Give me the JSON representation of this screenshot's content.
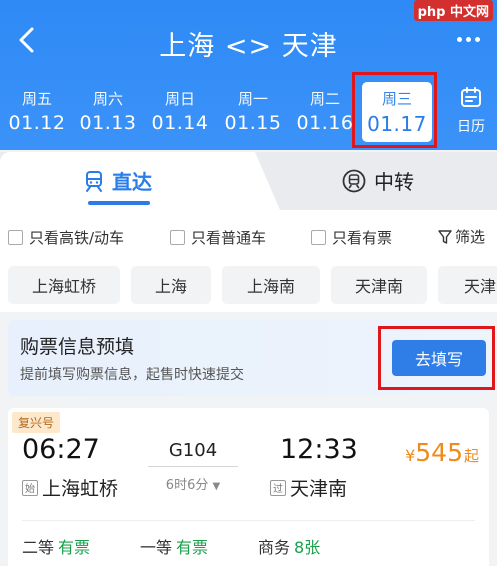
{
  "header": {
    "title": "上海 <> 天津",
    "watermark": "php 中文网"
  },
  "dates": [
    {
      "weekday": "周五",
      "date": "01.12",
      "selected": false
    },
    {
      "weekday": "周六",
      "date": "01.13",
      "selected": false
    },
    {
      "weekday": "周日",
      "date": "01.14",
      "selected": false
    },
    {
      "weekday": "周一",
      "date": "01.15",
      "selected": false
    },
    {
      "weekday": "周二",
      "date": "01.16",
      "selected": false
    },
    {
      "weekday": "周三",
      "date": "01.17",
      "selected": true
    }
  ],
  "calendar_label": "日历",
  "tabs": {
    "direct": "直达",
    "transfer": "中转"
  },
  "filters": {
    "high_speed": "只看高铁/动车",
    "normal": "只看普通车",
    "has_ticket": "只看有票",
    "filter_btn": "筛选"
  },
  "stations": [
    "上海虹桥",
    "上海",
    "上海南",
    "天津南",
    "天津"
  ],
  "prefill": {
    "title": "购票信息预填",
    "subtitle": "提前填写购票信息，起售时快速提交",
    "button": "去填写"
  },
  "train": {
    "badge": "复兴号",
    "depart_time": "06:27",
    "arrive_time": "12:33",
    "number": "G104",
    "duration": "6时6分",
    "depart_tag": "始",
    "depart_station": "上海虹桥",
    "arrive_tag": "过",
    "arrive_station": "天津南",
    "price_currency": "¥",
    "price": "545",
    "price_suffix": "起",
    "seats": [
      {
        "class": "二等",
        "status": "有票"
      },
      {
        "class": "一等",
        "status": "有票"
      },
      {
        "class": "商务",
        "status": "8张"
      }
    ]
  },
  "colors": {
    "primary": "#2f8af6",
    "accent_blue": "#2a7de9",
    "price": "#f08a1a",
    "available": "#1aa04b",
    "highlight": "#e0171a"
  }
}
